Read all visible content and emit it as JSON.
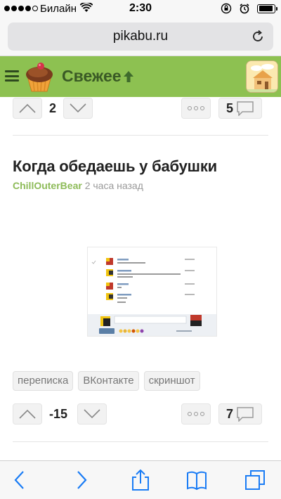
{
  "status_bar": {
    "carrier": "Билайн",
    "time": "2:30",
    "battery_level": 0.95
  },
  "browser": {
    "url": "pikabu.ru"
  },
  "site_header": {
    "section_title": "Свежее"
  },
  "prev_post": {
    "rating": "2",
    "comments_count": "5"
  },
  "post": {
    "title": "Когда обедаешь у бабушки",
    "author": "ChillOuterBear",
    "time_ago": "2 часа назад",
    "tags": [
      "переписка",
      "ВКонтакте",
      "скриншот"
    ],
    "rating": "-15",
    "comments_count": "7"
  },
  "colors": {
    "header_green": "#8dc151",
    "author_green": "#8dbb58",
    "ios_blue": "#1a7cf5"
  }
}
